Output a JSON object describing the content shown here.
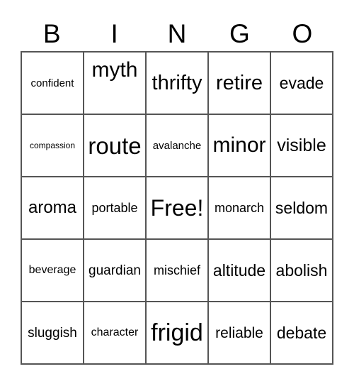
{
  "header": [
    "B",
    "I",
    "N",
    "G",
    "O"
  ],
  "rows": [
    [
      "confident",
      "myth",
      "thrifty",
      "retire",
      "evade"
    ],
    [
      "compassion",
      "route",
      "avalanche",
      "minor",
      "visible"
    ],
    [
      "aroma",
      "portable",
      "Free!",
      "monarch",
      "seldom"
    ],
    [
      "beverage",
      "guardian",
      "mischief",
      "altitude",
      "abolish"
    ],
    [
      "sluggish",
      "character",
      "frigid",
      "reliable",
      "debate"
    ]
  ]
}
